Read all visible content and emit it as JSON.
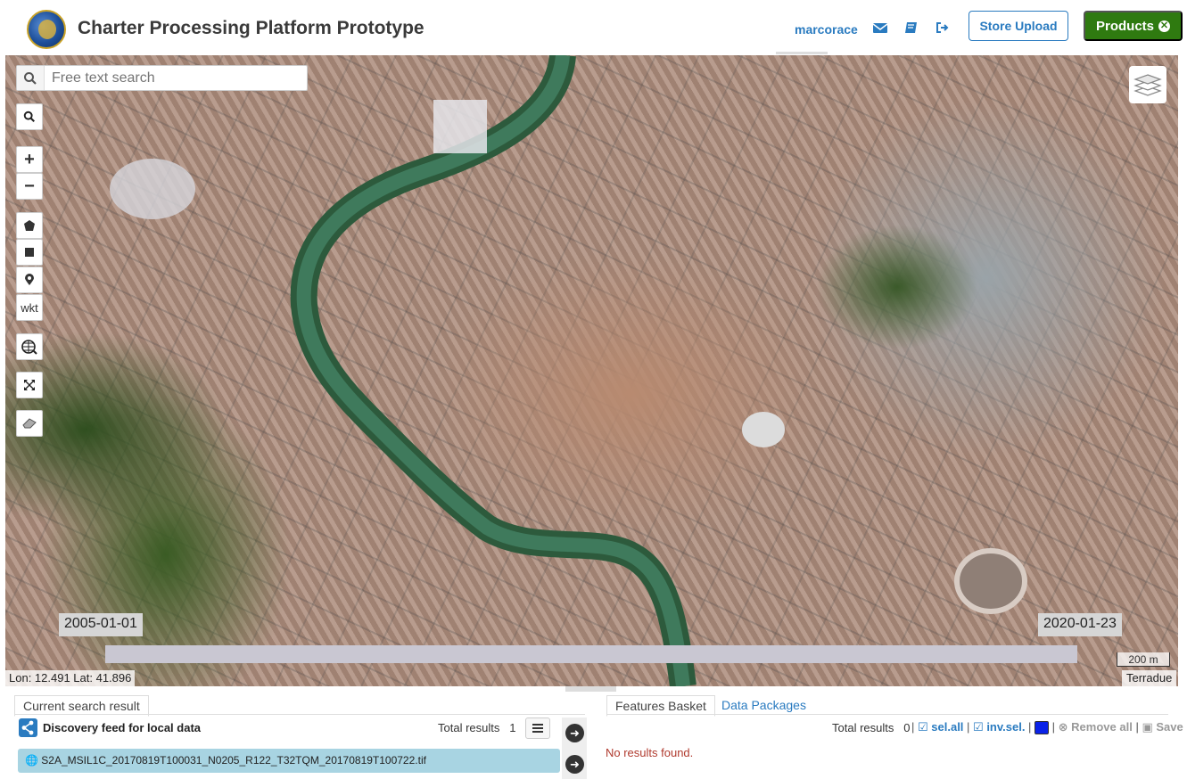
{
  "header": {
    "title": "Charter Processing Platform Prototype",
    "username": "marcorace",
    "store_upload_label": "Store Upload",
    "products_label": "Products",
    "icons": [
      "envelope-icon",
      "book-icon",
      "sign-out-icon"
    ]
  },
  "map": {
    "search_placeholder": "Free text search",
    "tools": {
      "zoom_in": "+",
      "zoom_out": "−",
      "wkt": "wkt"
    },
    "time_slider": {
      "start_label": "2005-01-01",
      "end_label": "2020-01-23"
    },
    "scale": "200 m",
    "coords": "Lon: 12.491 Lat: 41.896",
    "attribution": "Terradue"
  },
  "results_panel": {
    "tab_label": "Current search result",
    "feed_title": "Discovery feed for local data",
    "total_label": "Total results",
    "total_value": "1",
    "items": [
      "S2A_MSIL1C_20170819T100031_N0205_R122_T32TQM_20170819T100722.tif"
    ]
  },
  "basket_panel": {
    "tabs": [
      "Features Basket",
      "Data Packages"
    ],
    "total_label": "Total results",
    "total_value": "0",
    "sel_all": "sel.all",
    "inv_sel": "inv.sel.",
    "remove_all": "Remove all",
    "save": "Save",
    "empty_message": "No results found.",
    "basket_color": "#0a22e8"
  },
  "colors": {
    "accent": "#2a7bc0",
    "products_green": "#2f7a10",
    "selected_item": "#a8d4e2",
    "error": "#b03a2e"
  }
}
